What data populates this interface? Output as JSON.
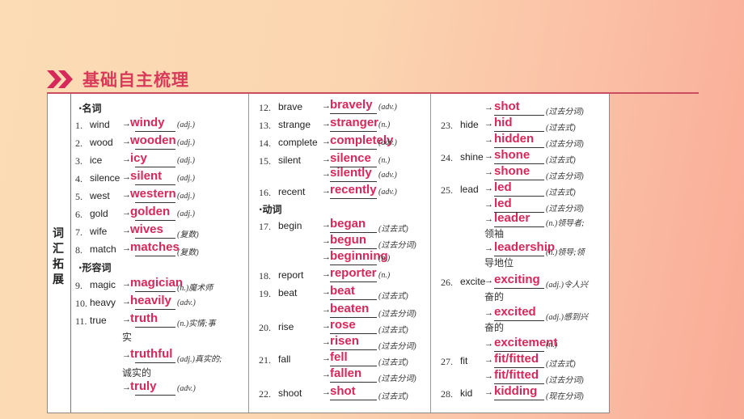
{
  "header": {
    "title": "基础自主梳理",
    "icon": "double-chevron-right-icon",
    "accent": "#d93a5a"
  },
  "side_label": "词汇拓展",
  "sections": {
    "noun": "·名词",
    "adj": "·形容词",
    "verb": "·动词"
  },
  "column1": [
    {
      "num": "1.",
      "word": "wind",
      "answer": "windy",
      "pos": "(adj.)"
    },
    {
      "num": "2.",
      "word": "wood",
      "answer": "wooden",
      "pos": "(adj.)"
    },
    {
      "num": "3.",
      "word": "ice",
      "answer": "icy",
      "pos": "(adj.)"
    },
    {
      "num": "4.",
      "word": "silence",
      "answer": "silent",
      "pos": "(adj.)"
    },
    {
      "num": "5.",
      "word": "west",
      "answer": "western",
      "pos": "(adj.)"
    },
    {
      "num": "6.",
      "word": "gold",
      "answer": "golden",
      "pos": "(adj.)"
    },
    {
      "num": "7.",
      "word": "wife",
      "answer": "wives",
      "pos": "(复数)"
    },
    {
      "num": "8.",
      "word": "match",
      "answer": "matches",
      "pos": "(复数)"
    },
    {
      "num": "9.",
      "word": "magic",
      "answer": "magician",
      "pos": "(n.)魔术师"
    },
    {
      "num": "10.",
      "word": "heavy",
      "answer": "heavily",
      "pos": "(adv.)"
    },
    {
      "num": "11.",
      "word": "true",
      "answer": "truth",
      "pos": "(n.)实情;事",
      "wrap": "实"
    },
    {
      "num": "",
      "word": "",
      "answer": "truthful",
      "pos": "(adj.)真实的;",
      "wrap": "诚实的"
    },
    {
      "num": "",
      "word": "",
      "answer": "truly",
      "pos": "(adv.)"
    }
  ],
  "column2": [
    {
      "num": "12.",
      "word": "brave",
      "answer": "bravely",
      "pos": "(adv.)"
    },
    {
      "num": "13.",
      "word": "strange",
      "answer": "stranger",
      "pos": "(n.)"
    },
    {
      "num": "14.",
      "word": "complete",
      "answer": "completely",
      "pos": "(adv.)"
    },
    {
      "num": "15.",
      "word": "silent",
      "answer": "silence",
      "pos": "(n.)"
    },
    {
      "num": "",
      "word": "",
      "answer": "silently",
      "pos": "(adv.)"
    },
    {
      "num": "16.",
      "word": "recent",
      "answer": "recently",
      "pos": "(adv.)"
    },
    {
      "num": "17.",
      "word": "begin",
      "answer": "began",
      "pos": "(过去式)"
    },
    {
      "num": "",
      "word": "",
      "answer": "begun",
      "pos": "(过去分词)"
    },
    {
      "num": "",
      "word": "",
      "answer": "beginning",
      "pos": "(n.)"
    },
    {
      "num": "18.",
      "word": "report",
      "answer": "reporter",
      "pos": "(n.)"
    },
    {
      "num": "19.",
      "word": "beat",
      "answer": "beat",
      "pos": "(过去式)"
    },
    {
      "num": "",
      "word": "",
      "answer": "beaten",
      "pos": "(过去分词)"
    },
    {
      "num": "20.",
      "word": "rise",
      "answer": "rose",
      "pos": "(过去式)"
    },
    {
      "num": "",
      "word": "",
      "answer": "risen",
      "pos": "(过去分词)"
    },
    {
      "num": "21.",
      "word": "fall",
      "answer": "fell",
      "pos": "(过去式)"
    },
    {
      "num": "",
      "word": "",
      "answer": "fallen",
      "pos": "(过去分词)"
    },
    {
      "num": "22.",
      "word": "shoot",
      "answer": "shot",
      "pos": "(过去式)"
    }
  ],
  "column3": [
    {
      "num": "",
      "word": "",
      "answer": "shot",
      "pos": "(过去分词)"
    },
    {
      "num": "23.",
      "word": "hide",
      "answer": "hid",
      "pos": "(过去式)"
    },
    {
      "num": "",
      "word": "",
      "answer": "hidden",
      "pos": "(过去分词)"
    },
    {
      "num": "24.",
      "word": "shine",
      "answer": "shone",
      "pos": "(过去式)"
    },
    {
      "num": "",
      "word": "",
      "answer": "shone",
      "pos": "(过去分词)"
    },
    {
      "num": "25.",
      "word": "lead",
      "answer": "led",
      "pos": "(过去式)"
    },
    {
      "num": "",
      "word": "",
      "answer": "led",
      "pos": "(过去分词)"
    },
    {
      "num": "",
      "word": "",
      "answer": "leader",
      "pos": "(n.)领导者;",
      "wrap": "领袖"
    },
    {
      "num": "",
      "word": "",
      "answer": "leadership",
      "pos": "(n.)领导;领",
      "wrap": "导地位"
    },
    {
      "num": "26.",
      "word": "excite",
      "answer": "exciting",
      "pos": "(adj.)令人兴",
      "wrap": "奋的"
    },
    {
      "num": "",
      "word": "",
      "answer": "excited",
      "pos": "(adj.)感到兴",
      "wrap": "奋的"
    },
    {
      "num": "",
      "word": "",
      "answer": "excitement",
      "pos": "(n.)"
    },
    {
      "num": "27.",
      "word": "fit",
      "answer": "fit/fitted",
      "pos": "(过去式)"
    },
    {
      "num": "",
      "word": "",
      "answer": "fit/fitted",
      "pos": "(过去分词)"
    },
    {
      "num": "28.",
      "word": "kid",
      "answer": "kidding",
      "pos": "(现在分词)"
    }
  ]
}
